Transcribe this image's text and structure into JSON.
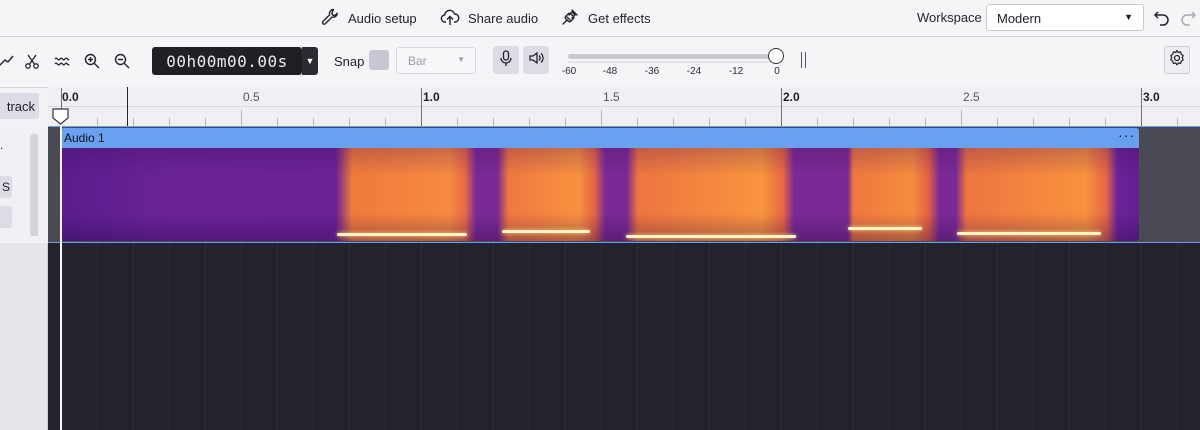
{
  "top_bar": {
    "audio_setup": "Audio setup",
    "share_audio": "Share audio",
    "get_effects": "Get effects",
    "workspace_label": "Workspace",
    "workspace_value": "Modern"
  },
  "toolbar": {
    "timecode": "00h00m00.00s",
    "snap_label": "Snap",
    "snap_value": "Bar",
    "meter_ticks": [
      "-60",
      "-48",
      "-36",
      "-24",
      "-12",
      "0"
    ]
  },
  "left_panel": {
    "add_track": "track",
    "btn_s": "S",
    "btn_dot": "."
  },
  "ruler": {
    "labels": [
      "0.0",
      "0.5",
      "1.0",
      "1.5",
      "2.0",
      "2.5",
      "3.0"
    ]
  },
  "track": {
    "clip_name": "Audio 1",
    "clip_menu": "···"
  },
  "colors": {
    "clip_header": "#69a0f0",
    "empty_area": "#23232d",
    "spectrogram_low": "#5a1d8e",
    "spectrogram_high": "#f8923e"
  }
}
